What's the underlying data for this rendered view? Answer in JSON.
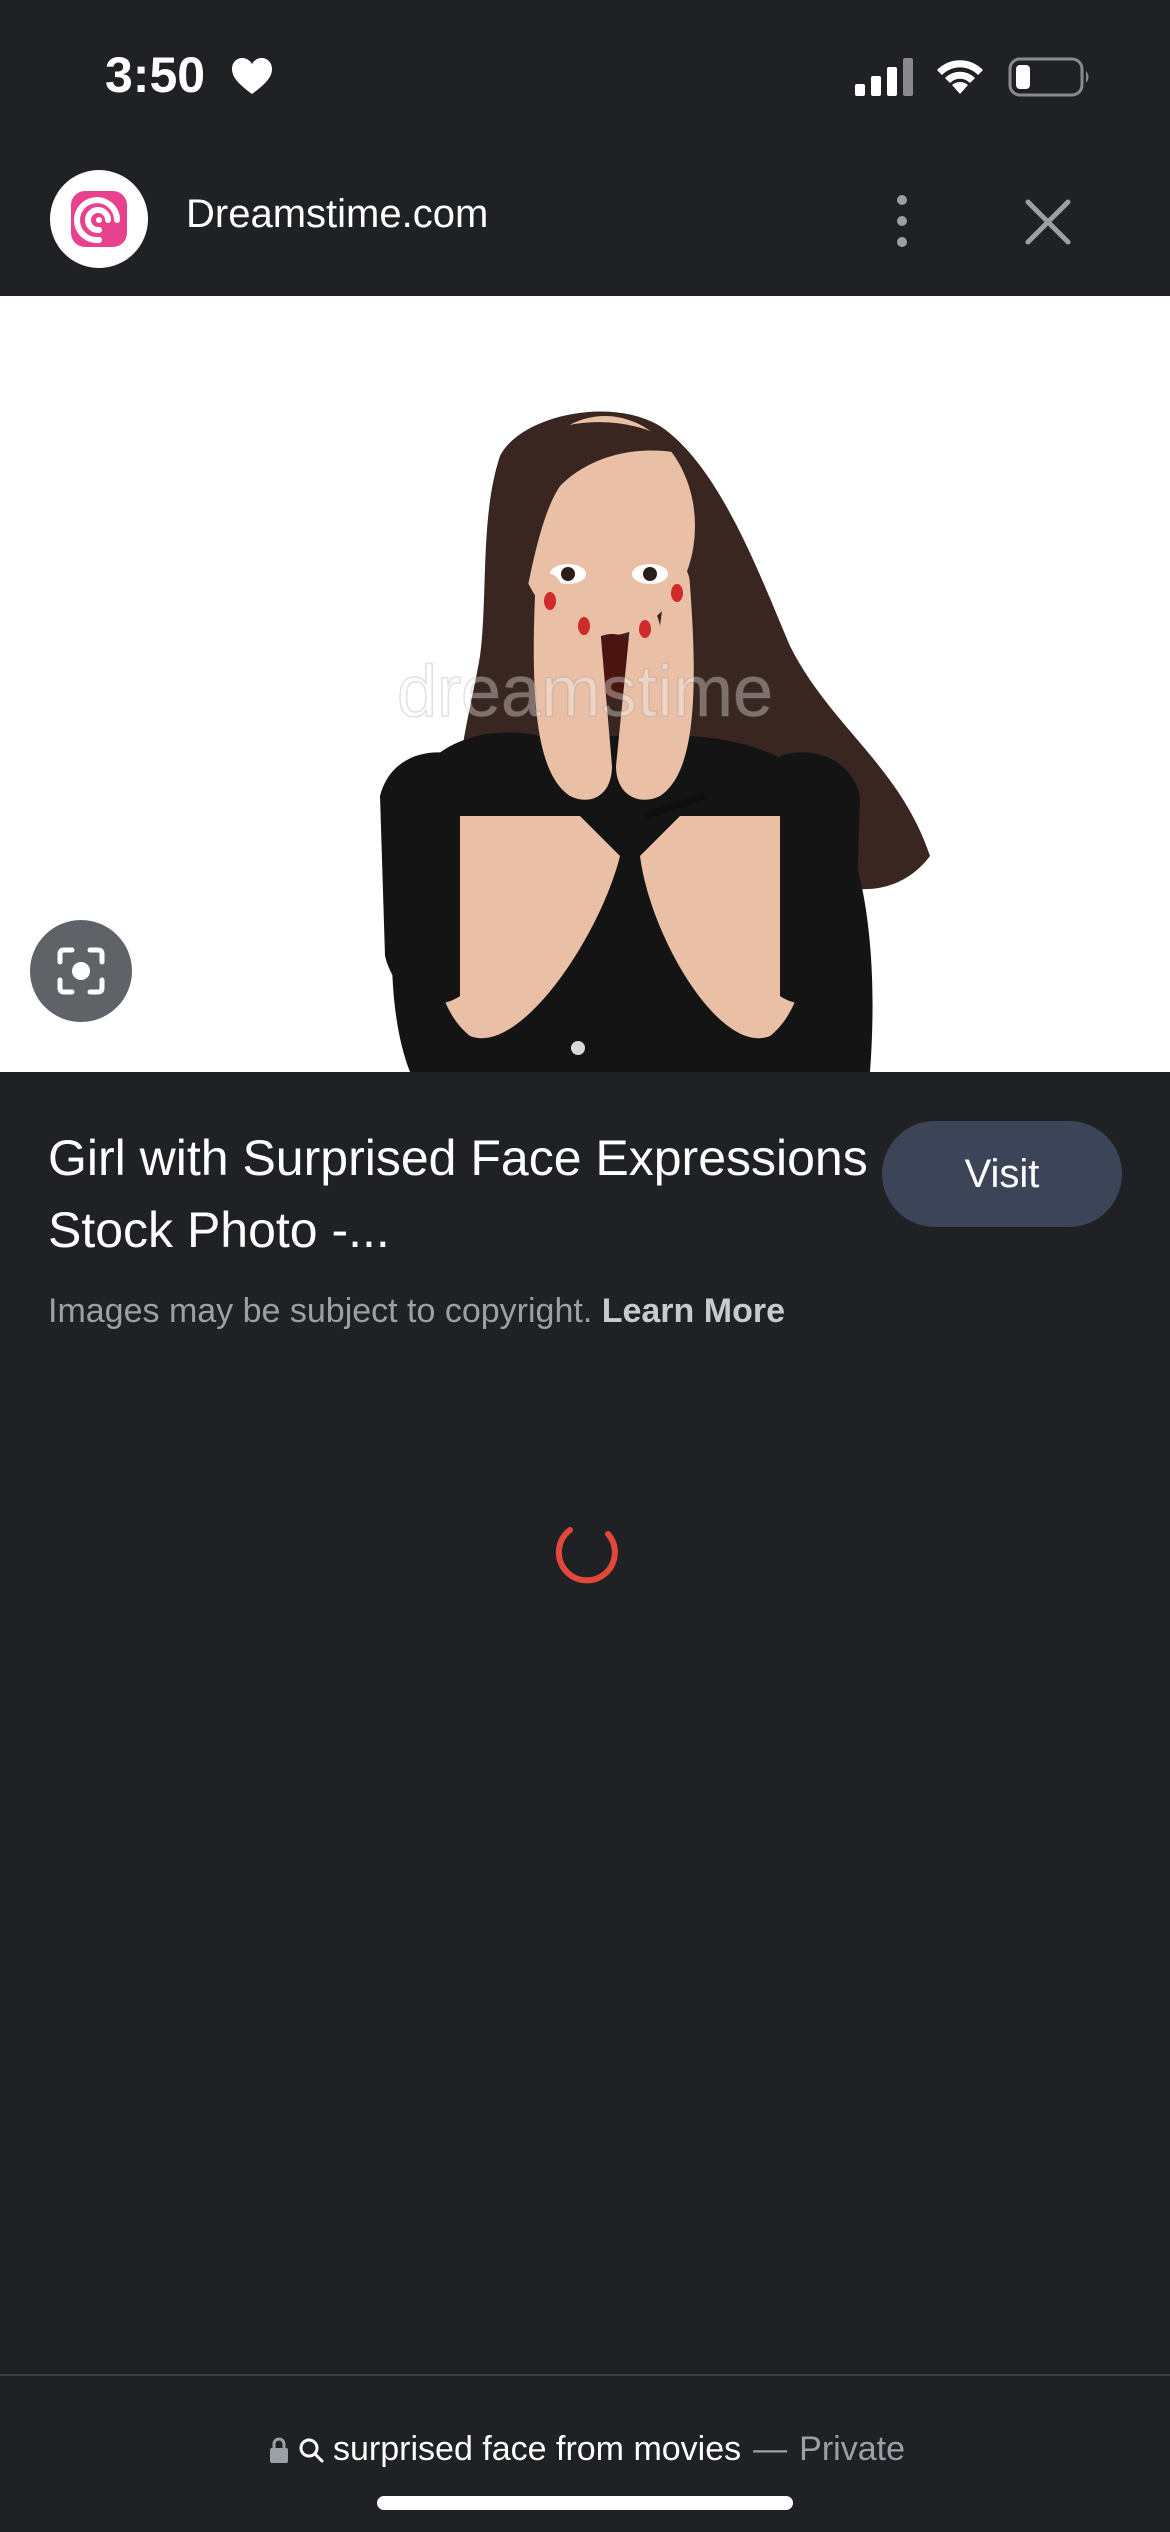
{
  "status_bar": {
    "time": "3:50",
    "icons": [
      "heart-icon",
      "cellular-signal-icon",
      "wifi-icon",
      "battery-icon"
    ]
  },
  "header": {
    "site_name": "Dreamstime.com",
    "logo_icon": "dreamstime-logo-icon",
    "more_icon": "more-vertical-icon",
    "close_icon": "close-icon"
  },
  "image": {
    "watermark": "dreamstime",
    "lens_icon": "lens-icon"
  },
  "result": {
    "title": "Girl with Surprised Face Expressions Stock Photo -...",
    "visit_label": "Visit",
    "copyright_text": "Images may be subject to copyright.",
    "learn_more_label": "Learn More"
  },
  "bottom_bar": {
    "query": "surprised face from movies",
    "separator": "—",
    "mode": "Private",
    "lock_icon": "lock-icon",
    "search_icon": "search-icon"
  },
  "colors": {
    "background": "#202124",
    "visit_button": "#3c4457",
    "spinner": "#e0483c",
    "logo_pink": "#e8418e"
  }
}
